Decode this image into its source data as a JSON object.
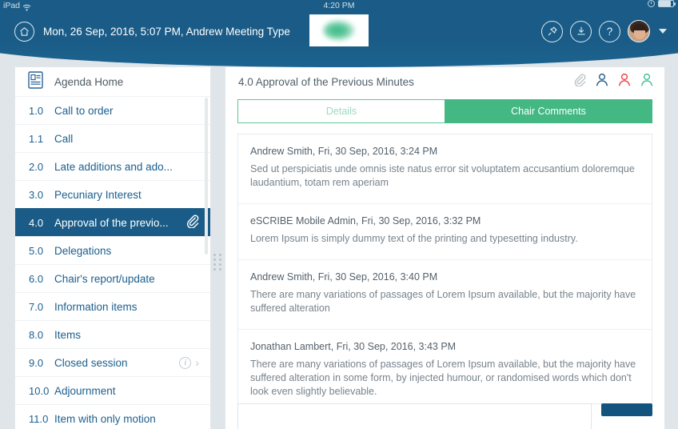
{
  "statusbar": {
    "device": "iPad",
    "wifi_icon": "wifi-icon",
    "time": "4:20 PM",
    "lock_icon": "rotation-lock-icon",
    "battery_icon": "battery-icon"
  },
  "header": {
    "home_icon": "home-icon",
    "meeting_title": "Mon, 26 Sep, 2016, 5:07 PM, Andrew Meeting Type",
    "logo": "escribe-logo",
    "actions": [
      {
        "name": "pin-button",
        "icon": "pin-icon"
      },
      {
        "name": "download-button",
        "icon": "download-icon"
      },
      {
        "name": "help-button",
        "icon": "question-mark-icon",
        "label": "?"
      }
    ],
    "avatar": "user-avatar",
    "caret": "chevron-down-icon",
    "brand_color": "#1a5c87"
  },
  "sidebar": {
    "home": {
      "icon": "agenda-document-icon",
      "label": "Agenda Home"
    },
    "items": [
      {
        "num": "1.0",
        "label": "Call to order",
        "active": false,
        "clip": false,
        "info": false
      },
      {
        "num": "1.1",
        "label": "Call",
        "active": false,
        "clip": false,
        "info": false
      },
      {
        "num": "2.0",
        "label": "Late additions and ado...",
        "active": false,
        "clip": false,
        "info": false
      },
      {
        "num": "3.0",
        "label": "Pecuniary Interest",
        "active": false,
        "clip": false,
        "info": false
      },
      {
        "num": "4.0",
        "label": "Approval of the previo...",
        "active": true,
        "clip": true,
        "info": false
      },
      {
        "num": "5.0",
        "label": "Delegations",
        "active": false,
        "clip": false,
        "info": false
      },
      {
        "num": "6.0",
        "label": "Chair's report/update",
        "active": false,
        "clip": false,
        "info": false
      },
      {
        "num": "7.0",
        "label": "Information items",
        "active": false,
        "clip": false,
        "info": false
      },
      {
        "num": "8.0",
        "label": "Items",
        "active": false,
        "clip": false,
        "info": false
      },
      {
        "num": "9.0",
        "label": "Closed session",
        "active": false,
        "clip": false,
        "info": true
      },
      {
        "num": "10.0",
        "label": "Adjournment",
        "active": false,
        "clip": false,
        "info": false
      },
      {
        "num": "11.0",
        "label": "Item with only motion",
        "active": false,
        "clip": false,
        "info": false
      }
    ],
    "resize_handle": "sidebar-resize-grip"
  },
  "main": {
    "title": "4.0 Approval of the Previous Minutes",
    "head_icons": [
      {
        "name": "attachment-icon",
        "color": "#b9bfc4"
      },
      {
        "name": "person-blue-icon",
        "color": "#2f6491"
      },
      {
        "name": "person-red-icon",
        "color": "#ee4a50"
      },
      {
        "name": "person-green-icon",
        "color": "#4cc395"
      }
    ],
    "tabs": [
      {
        "label": "Details",
        "active": false
      },
      {
        "label": "Chair Comments",
        "active": true
      }
    ],
    "accent_green": "#43b883",
    "comments": [
      {
        "meta": "Andrew Smith, Fri, 30 Sep, 2016, 3:24 PM",
        "body": "Sed ut perspiciatis unde omnis iste natus error sit voluptatem accusantium doloremque laudantium, totam rem aperiam"
      },
      {
        "meta": "eSCRIBE Mobile Admin, Fri, 30 Sep, 2016, 3:32 PM",
        "body": "Lorem Ipsum is simply dummy text of the printing and typesetting industry."
      },
      {
        "meta": "Andrew Smith, Fri, 30 Sep, 2016, 3:40 PM",
        "body": "There are many variations of passages of Lorem Ipsum available, but the majority have suffered alteration"
      },
      {
        "meta": "Jonathan Lambert, Fri, 30 Sep, 2016, 3:43 PM",
        "body": "There are many variations of passages of Lorem Ipsum available, but the majority have suffered alteration in some form, by injected humour, or randomised words which don't look even slightly believable."
      }
    ],
    "reply": {
      "placeholder": "",
      "value": "",
      "submit_color": "#13547e"
    }
  }
}
